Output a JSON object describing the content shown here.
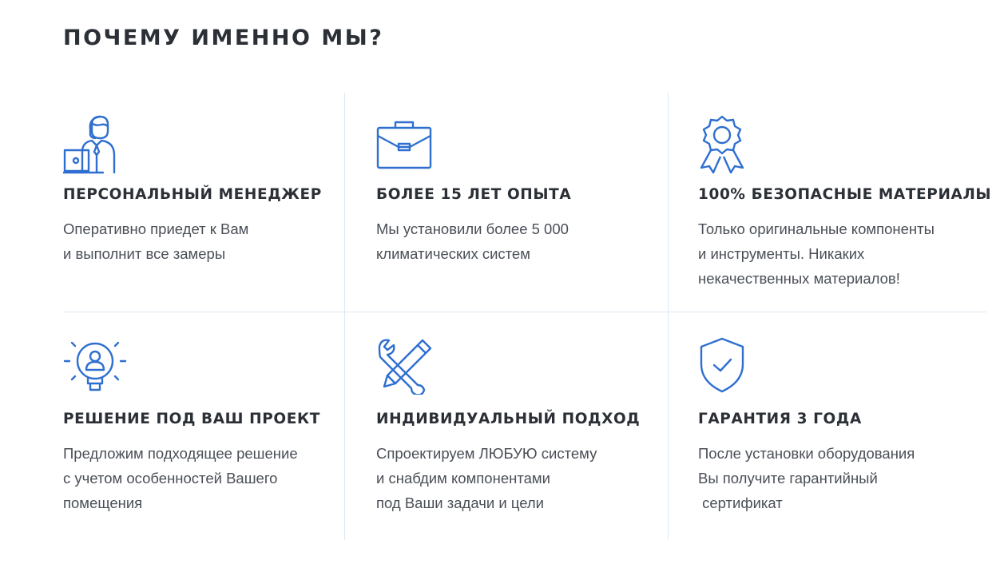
{
  "section": {
    "title": "ПОЧЕМУ ИМЕННО МЫ?"
  },
  "accent_color": "#2f6fd0",
  "features": [
    {
      "icon": "manager-with-laptop-icon",
      "title": "ПЕРСОНАЛЬНЫЙ МЕНЕДЖЕР",
      "lines": [
        "Оперативно приедет к Вам",
        "и выполнит все замеры"
      ]
    },
    {
      "icon": "briefcase-icon",
      "title": "БОЛЕЕ 15 ЛЕТ ОПЫТА",
      "lines": [
        "Мы установили более 5 000",
        "климатических систем"
      ]
    },
    {
      "icon": "award-badge-icon",
      "title": "100% БЕЗОПАСНЫЕ МАТЕРИАЛЫ",
      "lines": [
        "Только оригинальные компоненты",
        "и инструменты. Никаких",
        "некачественных материалов!"
      ]
    },
    {
      "icon": "lightbulb-person-icon",
      "title": "РЕШЕНИЕ ПОД ВАШ ПРОЕКТ",
      "lines": [
        "Предложим подходящее решение",
        "с учетом особенностей Вашего",
        "помещения"
      ]
    },
    {
      "icon": "wrench-pencil-icon",
      "title": "ИНДИВИДУАЛЬНЫЙ ПОДХОД",
      "lines": [
        "Спроектируем ЛЮБУЮ систему",
        "и снабдим компонентами",
        "под Ваши задачи и цели"
      ]
    },
    {
      "icon": "shield-check-icon",
      "title": "ГАРАНТИЯ 3 ГОДА",
      "lines": [
        "После установки оборудования",
        "Вы получите гарантийный",
        " сертификат"
      ]
    }
  ]
}
